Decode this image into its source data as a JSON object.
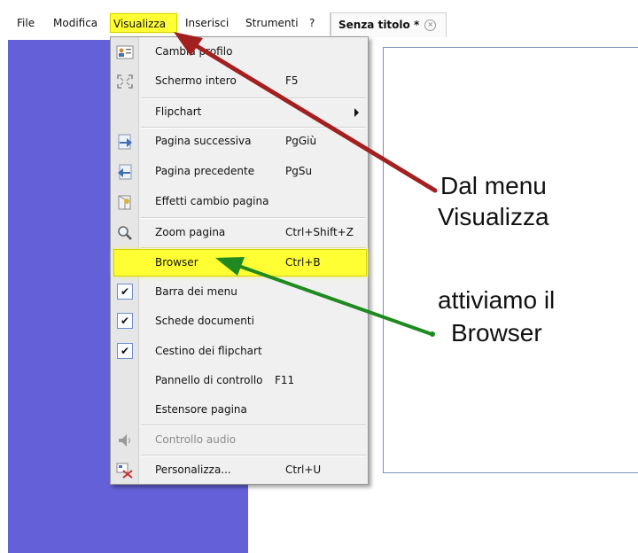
{
  "menubar": {
    "items": [
      {
        "label": "File"
      },
      {
        "label": "Modifica"
      },
      {
        "label": "Visualizza"
      },
      {
        "label": "Inserisci"
      },
      {
        "label": "Strumenti"
      },
      {
        "label": "?"
      }
    ]
  },
  "document_tab": {
    "title": "Senza titolo *",
    "close_glyph": "×"
  },
  "menu": {
    "items": [
      {
        "label": "Cambia profilo",
        "shortcut": "",
        "icon": "profile-icon"
      },
      {
        "label": "Schermo intero",
        "shortcut": "F5",
        "icon": "fullscreen-icon"
      },
      {
        "label": "Flipchart",
        "shortcut": "",
        "icon": ""
      },
      {
        "label": "Pagina successiva",
        "shortcut": "PgGiù",
        "icon": "next-page-icon"
      },
      {
        "label": "Pagina precedente",
        "shortcut": "PgSu",
        "icon": "previous-page-icon"
      },
      {
        "label": "Effetti cambio pagina",
        "shortcut": "",
        "icon": "page-effects-icon"
      },
      {
        "label": "Zoom pagina",
        "shortcut": "Ctrl+Shift+Z",
        "icon": "magnifier-icon"
      },
      {
        "label": "Browser",
        "shortcut": "Ctrl+B",
        "icon": ""
      },
      {
        "label": "Barra dei menu",
        "shortcut": "",
        "checked": true
      },
      {
        "label": "Schede documenti",
        "shortcut": "",
        "checked": true
      },
      {
        "label": "Cestino dei flipchart",
        "shortcut": "",
        "checked": true
      },
      {
        "label": "Pannello di controllo",
        "shortcut": "F11"
      },
      {
        "label": "Estensore pagina",
        "shortcut": ""
      },
      {
        "label": "Controllo audio",
        "shortcut": "",
        "disabled": true,
        "icon": "speaker-icon"
      },
      {
        "label": "Personalizza...",
        "shortcut": "Ctrl+U",
        "icon": "customize-icon"
      }
    ],
    "check_glyph": "✔"
  },
  "annotations": {
    "line1": "Dal menu",
    "line2": "Visualizza",
    "line3": "attiviamo il",
    "line4": "Browser"
  },
  "colors": {
    "highlight": "#ffff33",
    "panel": "#6460d8",
    "red_arrow": "#a32020",
    "green_arrow": "#1f8a1f"
  }
}
